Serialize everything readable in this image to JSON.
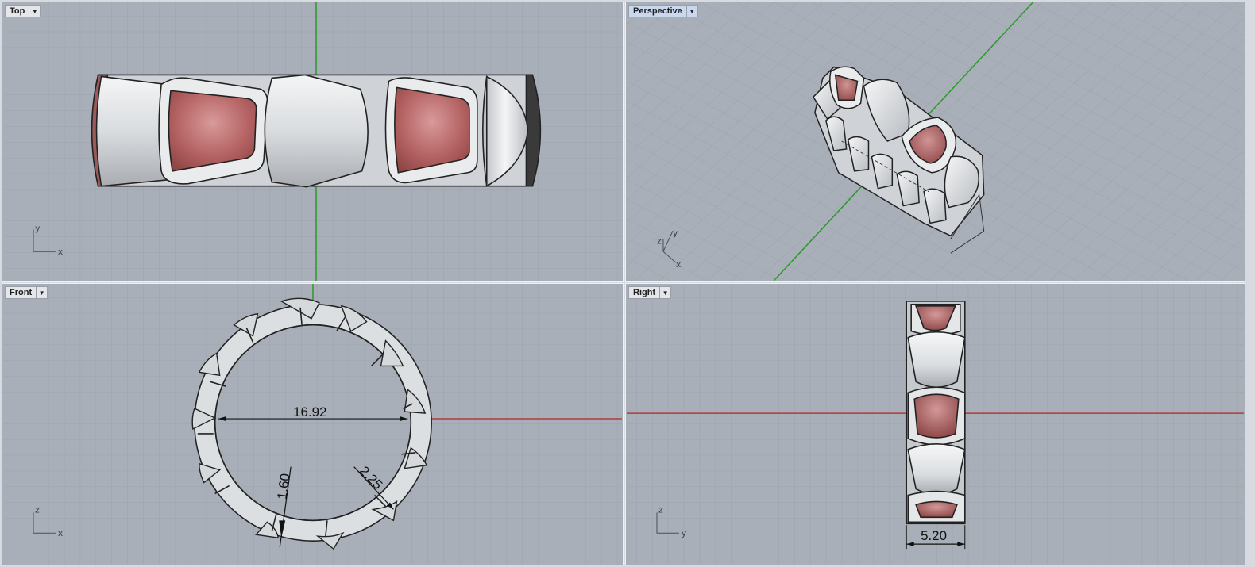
{
  "viewports": {
    "top": {
      "label": "Top",
      "axis_h": "x",
      "axis_v": "y"
    },
    "perspective": {
      "label": "Perspective",
      "axis_x": "x",
      "axis_y": "y",
      "axis_z": "z"
    },
    "front": {
      "label": "Front",
      "axis_h": "x",
      "axis_v": "z",
      "dim_diameter": "16.92",
      "dim_thickness": "1.60",
      "dim_width": "2.25"
    },
    "right": {
      "label": "Right",
      "axis_h": "y",
      "axis_v": "z",
      "dim_band_width": "5.20"
    }
  },
  "colors": {
    "viewport_bg": "#a9afb8",
    "grid_minor": "#9da3ac",
    "grid_major": "#8b919a",
    "axis_x": "#b23a3a",
    "axis_y": "#2a9a2a",
    "metal": "#e4e6e8",
    "gem": "#b76464"
  }
}
